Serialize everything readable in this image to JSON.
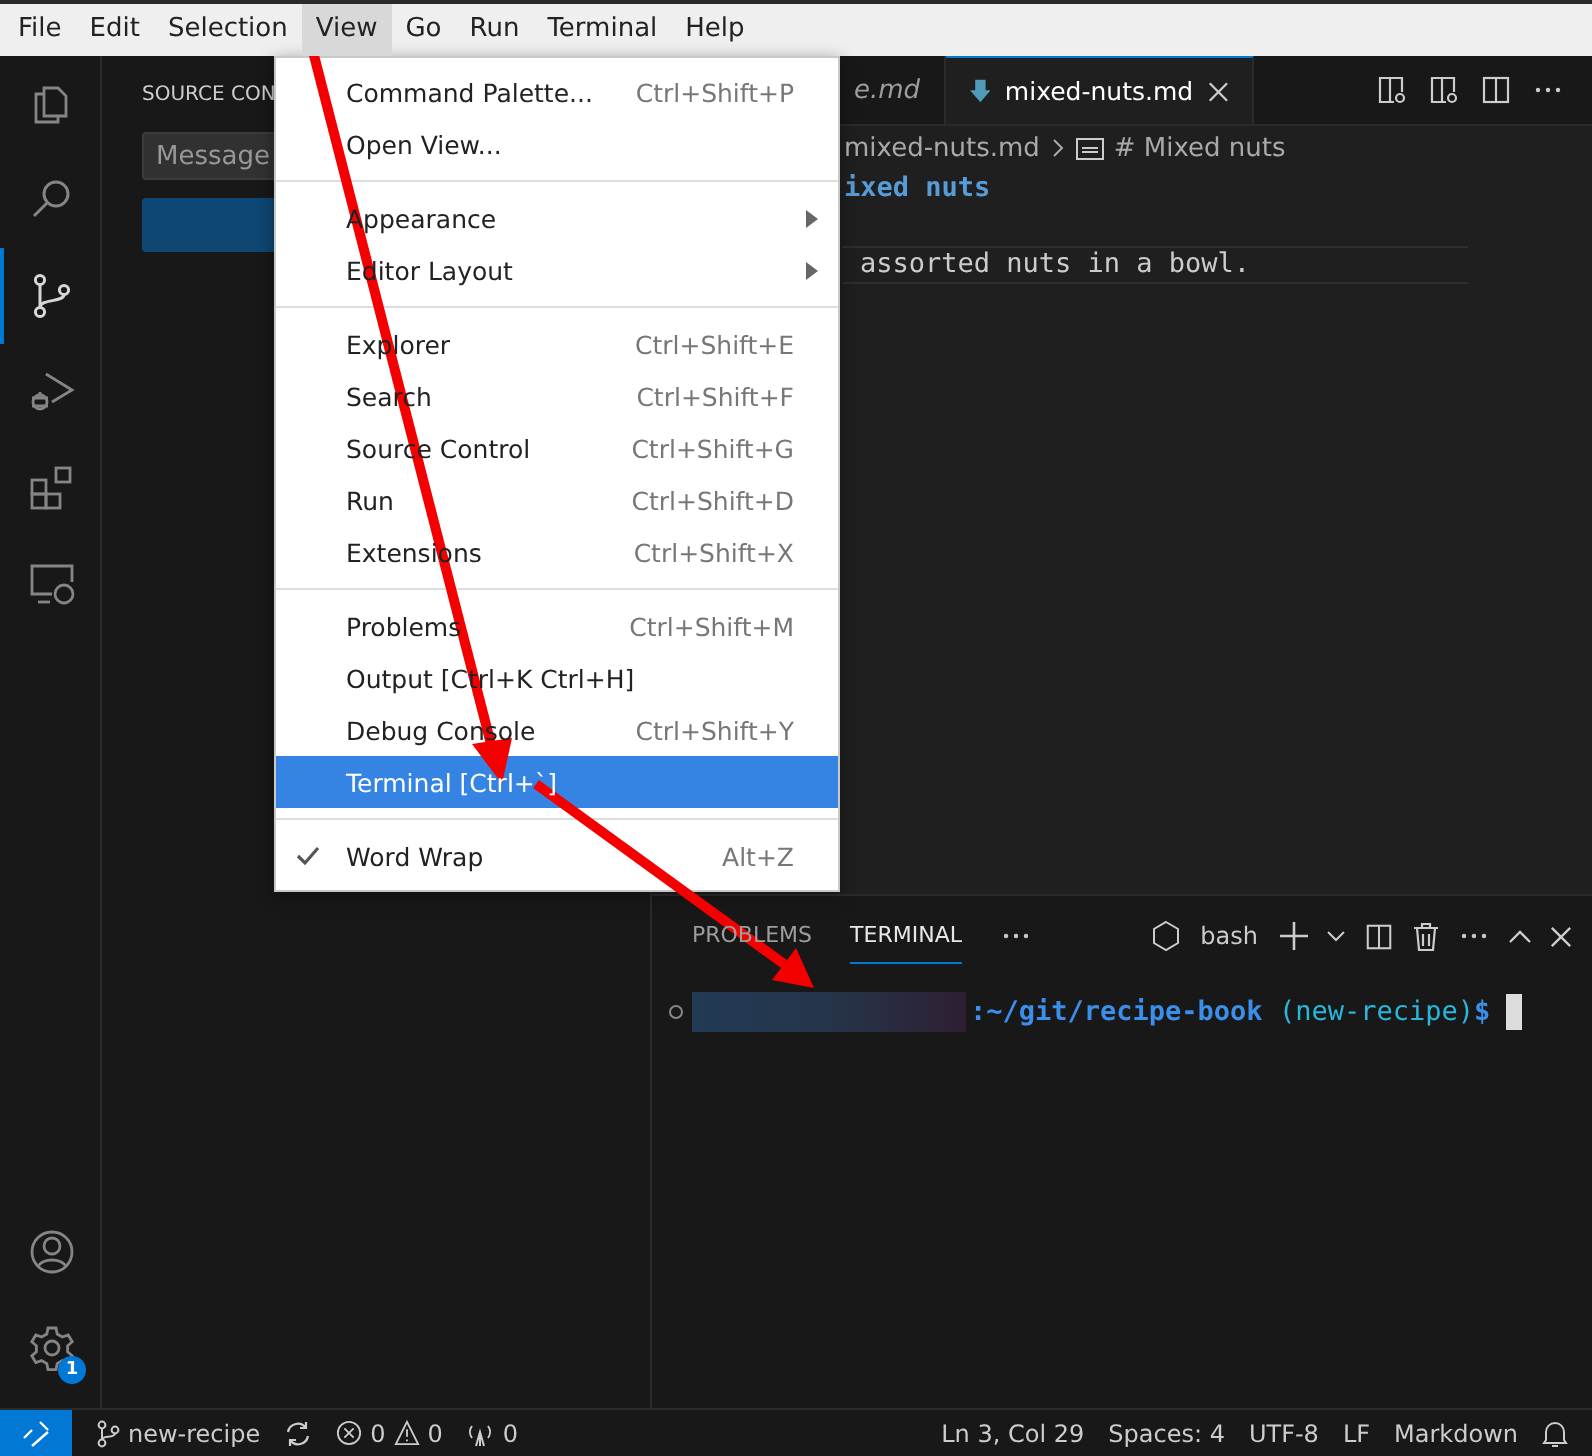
{
  "menubar": [
    {
      "label": "File",
      "selected": false
    },
    {
      "label": "Edit",
      "selected": false
    },
    {
      "label": "Selection",
      "selected": false
    },
    {
      "label": "View",
      "selected": true
    },
    {
      "label": "Go",
      "selected": false
    },
    {
      "label": "Run",
      "selected": false
    },
    {
      "label": "Terminal",
      "selected": false
    },
    {
      "label": "Help",
      "selected": false
    }
  ],
  "activity_bar": {
    "items": [
      {
        "kind": "files",
        "selected": false
      },
      {
        "kind": "search",
        "selected": false
      },
      {
        "kind": "source-control",
        "selected": true
      },
      {
        "kind": "run-debug",
        "selected": false
      },
      {
        "kind": "extensions",
        "selected": false
      },
      {
        "kind": "remote",
        "selected": false
      }
    ],
    "settings_badge": "1"
  },
  "sidebar": {
    "title": "SOURCE CON",
    "message_placeholder": "Message"
  },
  "editor": {
    "tabs": [
      {
        "label": "e.md",
        "selected": false
      },
      {
        "label": "mixed-nuts.md",
        "selected": true
      }
    ],
    "breadcrumb": [
      "mixed-nuts.md",
      "# Mixed nuts"
    ],
    "lines": [
      {
        "kind": "heading",
        "text": "ixed nuts",
        "current": false
      },
      {
        "kind": "blank",
        "current": false
      },
      {
        "kind": "text",
        "text": "assorted nuts in a bowl.",
        "current": true
      }
    ]
  },
  "view_menu": {
    "groups": [
      [
        {
          "label": "Command Palette...",
          "shortcut": "Ctrl+Shift+P",
          "submenu": false,
          "checked": false,
          "selected": false
        },
        {
          "label": "Open View...",
          "submenu": false,
          "checked": false,
          "selected": false
        }
      ],
      [
        {
          "label": "Appearance",
          "submenu": true,
          "checked": false,
          "selected": false
        },
        {
          "label": "Editor Layout",
          "submenu": true,
          "checked": false,
          "selected": false
        }
      ],
      [
        {
          "label": "Explorer",
          "shortcut": "Ctrl+Shift+E",
          "submenu": false,
          "checked": false,
          "selected": false
        },
        {
          "label": "Search",
          "shortcut": "Ctrl+Shift+F",
          "submenu": false,
          "checked": false,
          "selected": false
        },
        {
          "label": "Source Control",
          "shortcut": "Ctrl+Shift+G",
          "submenu": false,
          "checked": false,
          "selected": false
        },
        {
          "label": "Run",
          "shortcut": "Ctrl+Shift+D",
          "submenu": false,
          "checked": false,
          "selected": false
        },
        {
          "label": "Extensions",
          "shortcut": "Ctrl+Shift+X",
          "submenu": false,
          "checked": false,
          "selected": false
        }
      ],
      [
        {
          "label": "Problems",
          "shortcut": "Ctrl+Shift+M",
          "submenu": false,
          "checked": false,
          "selected": false
        },
        {
          "label": "Output [Ctrl+K Ctrl+H]",
          "submenu": false,
          "checked": false,
          "selected": false
        },
        {
          "label": "Debug Console",
          "shortcut": "Ctrl+Shift+Y",
          "submenu": false,
          "checked": false,
          "selected": false
        },
        {
          "label": "Terminal [Ctrl+`]",
          "submenu": false,
          "checked": false,
          "selected": true
        }
      ],
      [
        {
          "label": "Word Wrap",
          "shortcut": "Alt+Z",
          "submenu": false,
          "checked": true,
          "selected": false
        }
      ]
    ]
  },
  "panel": {
    "tabs": [
      {
        "label": "PROBLEMS",
        "selected": false
      },
      {
        "label": "TERMINAL",
        "selected": true
      }
    ],
    "shell": "bash",
    "prompt": {
      "path": ":~/git/recipe-book",
      "branch": " (new-recipe)",
      "symbol": "$"
    }
  },
  "status_bar": {
    "branch": "new-recipe",
    "errors": "0",
    "warnings": "0",
    "ports": "0",
    "position": "Ln 3, Col 29",
    "spaces": "Spaces: 4",
    "encoding": "UTF-8",
    "eol": "LF",
    "language": "Markdown"
  }
}
